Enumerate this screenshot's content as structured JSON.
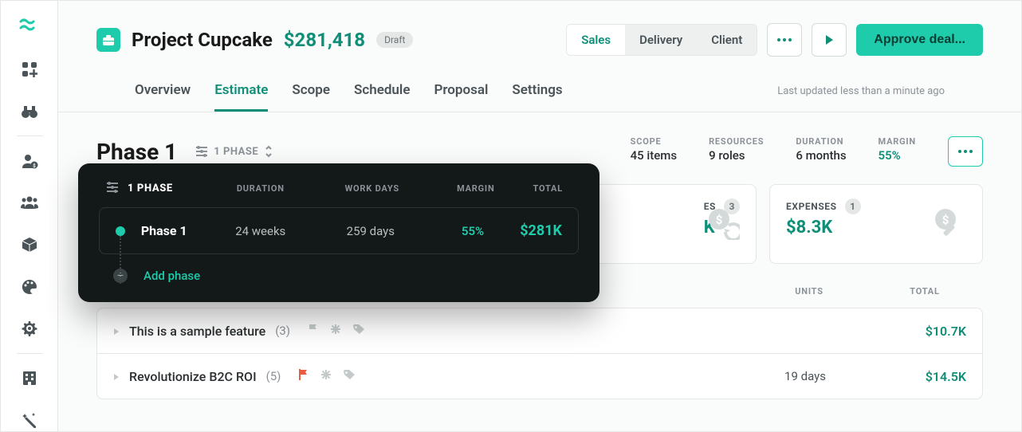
{
  "header": {
    "project_name": "Project Cupcake",
    "amount": "$281,418",
    "status": "Draft",
    "segments": {
      "sales": "Sales",
      "delivery": "Delivery",
      "client": "Client"
    },
    "approve": "Approve deal..."
  },
  "tabs": {
    "overview": "Overview",
    "estimate": "Estimate",
    "scope": "Scope",
    "schedule": "Schedule",
    "proposal": "Proposal",
    "settings": "Settings"
  },
  "last_updated": "Last updated less than a minute ago",
  "phase": {
    "title": "Phase 1",
    "selector_label": "1 PHASE",
    "stats": {
      "scope_label": "SCOPE",
      "scope_value": "45 items",
      "resources_label": "RESOURCES",
      "resources_value": "9 roles",
      "duration_label": "DURATION",
      "duration_value": "6 months",
      "margin_label": "MARGIN",
      "margin_value": "55%"
    }
  },
  "cards": {
    "partial_label_1": "ES",
    "partial_count_1": "3",
    "partial_value_1": "K",
    "expenses_label": "EXPENSES",
    "expenses_count": "1",
    "expenses_value": "$8.3K"
  },
  "columns": {
    "units": "UNITS",
    "total": "TOTAL"
  },
  "features": [
    {
      "name": "This is a sample feature",
      "count": "(3)",
      "units": "",
      "total": "$10.7K",
      "flag": false
    },
    {
      "name": "Revolutionize B2C ROI",
      "count": "(5)",
      "units": "19 days",
      "total": "$14.5K",
      "flag": true
    }
  ],
  "popover": {
    "header_label": "1 PHASE",
    "cols": {
      "duration": "DURATION",
      "workdays": "WORK DAYS",
      "margin": "MARGIN",
      "total": "TOTAL"
    },
    "row": {
      "name": "Phase 1",
      "duration": "24 weeks",
      "workdays": "259 days",
      "margin": "55%",
      "total": "$281K"
    },
    "add_phase": "Add phase"
  }
}
